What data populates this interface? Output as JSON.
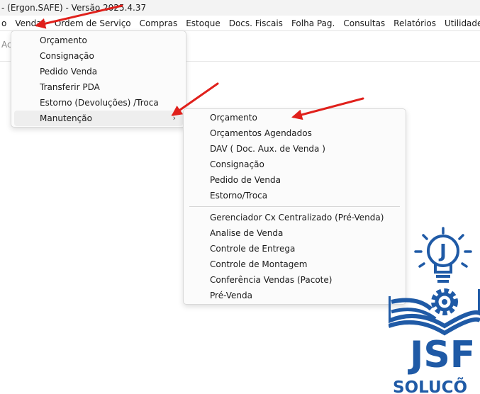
{
  "window": {
    "title": "- (Ergon.SAFE) - Versão 2025.4.37"
  },
  "menubar": {
    "items": [
      "o",
      "Vendas",
      "Ordem de Serviço",
      "Compras",
      "Estoque",
      "Docs. Fiscais",
      "Folha Pag.",
      "Consultas",
      "Relatórios",
      "Utilidades"
    ]
  },
  "toolbar": {
    "fragment": "Ac"
  },
  "vendas_menu": {
    "items": [
      "Orçamento",
      "Consignação",
      "Pedido Venda",
      "Transferir PDA",
      "Estorno (Devoluções) /Troca",
      "Manutenção"
    ],
    "submenu_glyph": "›"
  },
  "manutencao_menu": {
    "group1": [
      "Orçamento",
      "Orçamentos Agendados",
      "DAV ( Doc. Aux. de Venda )",
      "Consignação",
      "Pedido de Venda",
      "Estorno/Troca"
    ],
    "group2": [
      "Gerenciador Cx Centralizado (Pré-Venda)",
      "Analise de Venda",
      "Controle de Entrega",
      "Controle de Montagem",
      "Conferência Vendas (Pacote)",
      "Pré-Venda"
    ]
  },
  "logo": {
    "letter": "J",
    "brand": "JSF",
    "tagline": "SOLUCÕ",
    "color": "#1f5aa6"
  },
  "annotations": {
    "arrow_color": "#e0201b"
  }
}
